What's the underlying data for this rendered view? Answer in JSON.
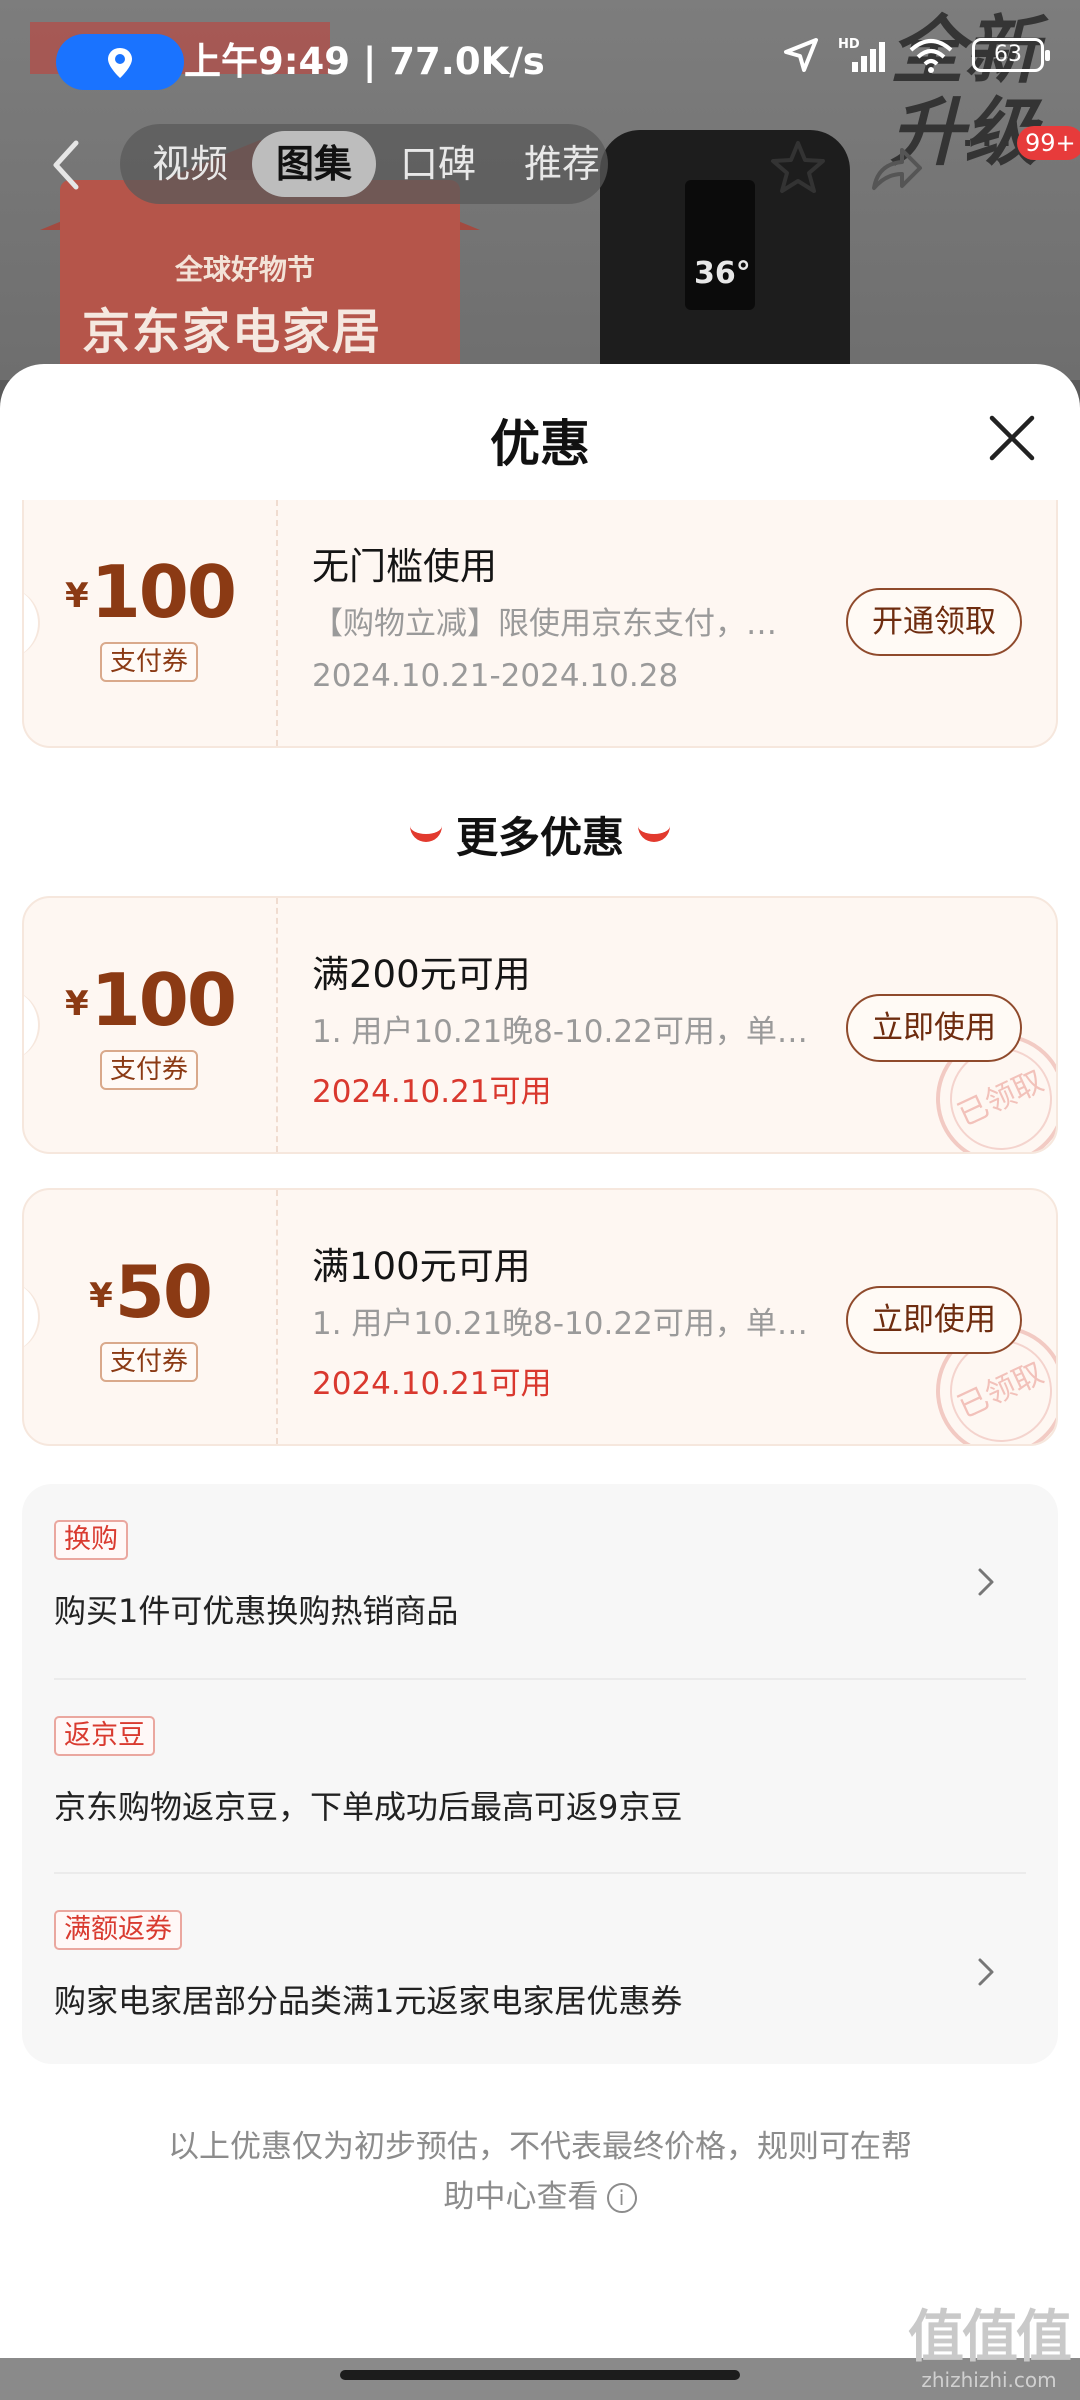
{
  "background": {
    "promo_line1": "全球好物节",
    "promo_line2": "京东家电家居",
    "corner_text": "全新升级",
    "badge_count": "99+",
    "product_temp": "36°"
  },
  "status_bar": {
    "time_speed": "上午9:49 | 77.0K/s",
    "battery": "63"
  },
  "nav": {
    "tabs": [
      "视频",
      "图集",
      "口碑",
      "推荐"
    ],
    "active_tab": "图集"
  },
  "sheet": {
    "title": "优惠",
    "coupons": [
      {
        "currency": "¥",
        "amount": "100",
        "tag": "支付券",
        "title": "无门槛使用",
        "desc": "【购物立减】限使用京东支付，…",
        "date": "2024.10.21-2024.10.28",
        "button": "开通领取"
      }
    ],
    "more_title": "更多优惠",
    "more_coupons": [
      {
        "currency": "¥",
        "amount": "100",
        "tag": "支付券",
        "title": "满200元可用",
        "desc": "1. 用户10.21晚8-10.22可用，单…",
        "date": "2024.10.21可用",
        "button": "立即使用",
        "stamp": "已领取"
      },
      {
        "currency": "¥",
        "amount": "50",
        "tag": "支付券",
        "title": "满100元可用",
        "desc": "1. 用户10.21晚8-10.22可用，单…",
        "date": "2024.10.21可用",
        "button": "立即使用",
        "stamp": "已领取"
      }
    ],
    "benefits": [
      {
        "tag": "换购",
        "text": "购买1件可优惠换购热销商品",
        "has_arrow": true
      },
      {
        "tag": "返京豆",
        "text": "京东购物返京豆，下单成功后最高可返9京豆",
        "has_arrow": false
      },
      {
        "tag": "满额返券",
        "text": "购家电家居部分品类满1元返家电家居优惠券",
        "has_arrow": true
      }
    ],
    "footnote_line1": "以上优惠仅为初步预估，不代表最终价格，规则可在帮",
    "footnote_line2": "助中心查看",
    "info_icon": "i"
  },
  "watermark": {
    "logo": "值值值",
    "url": "zhizhizhi.com"
  },
  "colors": {
    "accent_red": "#d9382e",
    "coupon_brown": "#8b3a14",
    "coupon_bg": "#fef7f2"
  }
}
